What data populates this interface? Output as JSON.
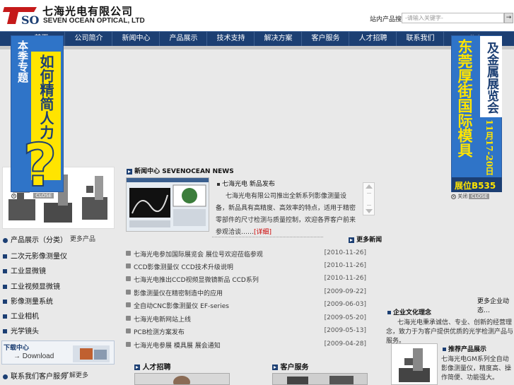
{
  "header": {
    "logo_cn": "七海光电有限公司",
    "logo_en": "SEVEN OCEAN OPTICAL, LTD",
    "search_label": "站内产品搜索：",
    "search_placeholder": "-请输入关键字-",
    "search_go": "→"
  },
  "nav": {
    "items": [
      "首页",
      "公司简介",
      "新闻中心",
      "产品展示",
      "技术支持",
      "解决方案",
      "客户服务",
      "人才招聘",
      "联系我们",
      "English"
    ]
  },
  "left_banner": {
    "line1": "本季专题",
    "line2": "如何精简人力",
    "close": "CLOSE"
  },
  "right_banner": {
    "line1": "东莞厚街国际模具",
    "line2": "及金属展览会",
    "dates": "11月17-20日",
    "booth": "展位B535",
    "close_cn": "关闭",
    "close_en": "CLOSE"
  },
  "left_column": {
    "products_head": "产品展示（分类）",
    "products_more": "更多产品",
    "products": [
      "二次元影像测量仪",
      "工业显微镜",
      "工业视频显微镜",
      "影像测量系统",
      "工业相机",
      "光学镜头"
    ],
    "download_cn": "下载中心",
    "download_en": "Download",
    "service_head": "联系我们客户服务",
    "service_more": "了解更多"
  },
  "news": {
    "title": "新闻中心 SEVENOCEAN NEWS",
    "headline": "七海光电 新品发布",
    "body": "七海光电有限公司推出全新系列影像测量设备，新品具有高精度、高效率的特点，适用于精密零部件的尺寸检测与质量控制，欢迎各界客户前来参观洽谈……",
    "more_link": "[详细]",
    "more": "更多新闻",
    "items": [
      {
        "title": "七海光电参加国际展览会 展位号欢迎莅临参观",
        "date": "[2010-11-26]"
      },
      {
        "title": "CCD影像测量仪 CCD技术升级说明",
        "date": "[2010-11-26]"
      },
      {
        "title": "七海光电推出CCD视频显微镜新品 CCD系列",
        "date": "[2010-11-26]"
      },
      {
        "title": "影像测量仪在精密制造中的应用",
        "date": "[2009-09-22]"
      },
      {
        "title": "全自动CNC影像测量仪 EF-series",
        "date": "[2009-06-03]"
      },
      {
        "title": "七海光电新网站上线",
        "date": "[2009-05-20]"
      },
      {
        "title": "PCB检测方案发布",
        "date": "[2009-05-13]"
      },
      {
        "title": "七海光电参展 模具展 展会通知",
        "date": "[2009-04-28]"
      }
    ]
  },
  "bottom": {
    "sec_a": "人才招聘",
    "sec_b": "客户服务"
  },
  "right_column": {
    "more": "更多企业动态…",
    "sec1_title": "企业文化理念",
    "sec1_text": "七海光电秉承诚信、专业、创新的经营理念，致力于为客户提供优质的光学检测产品与服务。",
    "prod_title": "推荐产品展示",
    "prod_text": "七海光电GM系列全自动影像测量仪，精度高、操作简便、功能强大。"
  },
  "colors": {
    "nav_bg": "#1c3f73",
    "banner_blue": "#2f74c8",
    "banner_yellow": "#ffe400",
    "link_red": "#cc0000"
  }
}
